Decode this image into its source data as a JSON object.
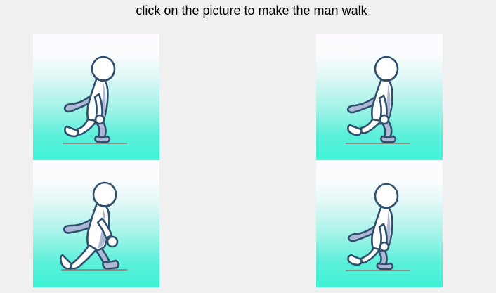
{
  "instruction": "click on the picture to make the man walk",
  "colors": {
    "background": "#f0f0f0",
    "gradient_top": "#fdfbff",
    "gradient_bottom": "#3ef2d6",
    "figure_fill": "#ffffff",
    "figure_shade": "#aeb9d6",
    "figure_outline": "#2e4f6e",
    "ground_line": "#a0706a"
  },
  "frames": [
    {
      "pose": "stride-mid-1",
      "icon": "walking-man-icon"
    },
    {
      "pose": "stride-mid-2",
      "icon": "walking-man-icon"
    },
    {
      "pose": "stride-wide",
      "icon": "walking-man-icon"
    },
    {
      "pose": "stride-passing",
      "icon": "walking-man-icon"
    }
  ]
}
